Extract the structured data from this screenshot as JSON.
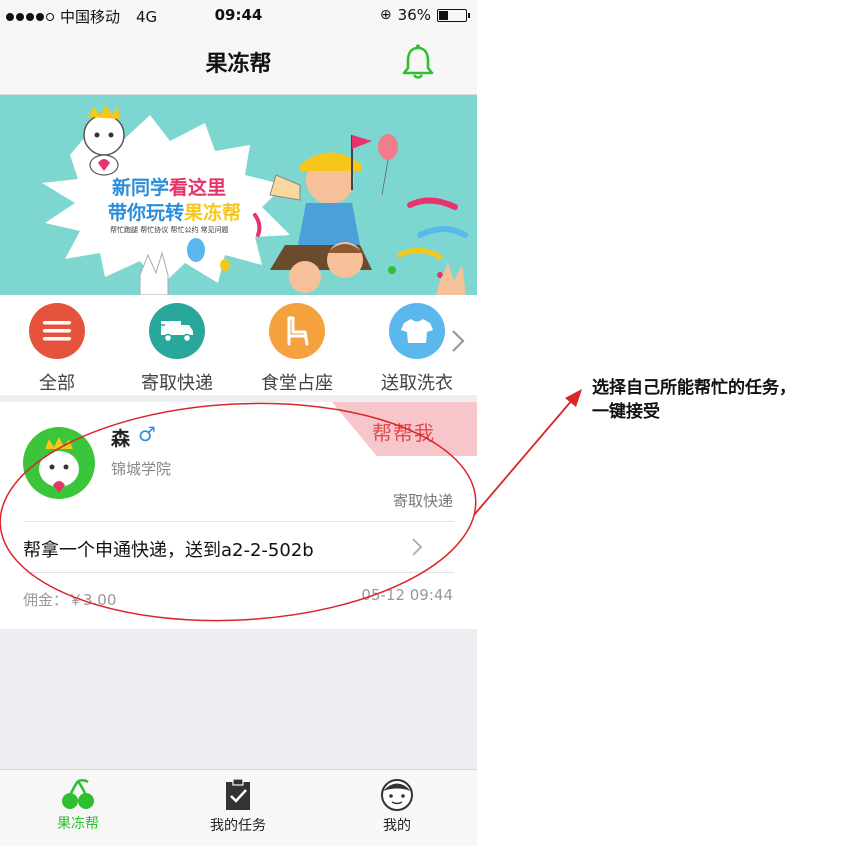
{
  "status_bar": {
    "carrier": "中国移动",
    "network": "4G",
    "time": "09:44",
    "battery": "36%",
    "battery_level": 0.36
  },
  "nav": {
    "title": "果冻帮"
  },
  "banner": {
    "line1_a": "新同学",
    "line1_b": "看这里",
    "line2_a": "带你玩转",
    "line2_b": "果冻帮",
    "small_text": "帮忙跑腿 帮忙协议 帮忙公约 常见问题"
  },
  "categories": [
    {
      "label": "全部",
      "icon": "menu-icon",
      "color": "#e6533c"
    },
    {
      "label": "寄取快递",
      "icon": "truck-icon",
      "color": "#2aa79b"
    },
    {
      "label": "食堂占座",
      "icon": "chair-icon",
      "color": "#f4a13e"
    },
    {
      "label": "送取洗衣",
      "icon": "shirt-icon",
      "color": "#5ab8ec"
    }
  ],
  "task": {
    "ribbon": "帮帮我",
    "user_name": "森",
    "gender": "♂",
    "school": "锦城学院",
    "category": "寄取快递",
    "description": "帮拿一个申通快递，送到a2-2-502b",
    "fee": "佣金：￥3.00",
    "time": "05-12 09:44"
  },
  "tabs": [
    {
      "label": "果冻帮",
      "icon": "cherry-icon"
    },
    {
      "label": "我的任务",
      "icon": "clipboard-icon"
    },
    {
      "label": "我的",
      "icon": "avatar-icon"
    }
  ],
  "colors": {
    "accent_green": "#2fbf2f",
    "annotation_red": "#d8262a",
    "ribbon_pink": "#f6c6cb"
  },
  "annotation": {
    "line1": "选择自己所能帮忙的任务，",
    "line2": "一键接受"
  }
}
